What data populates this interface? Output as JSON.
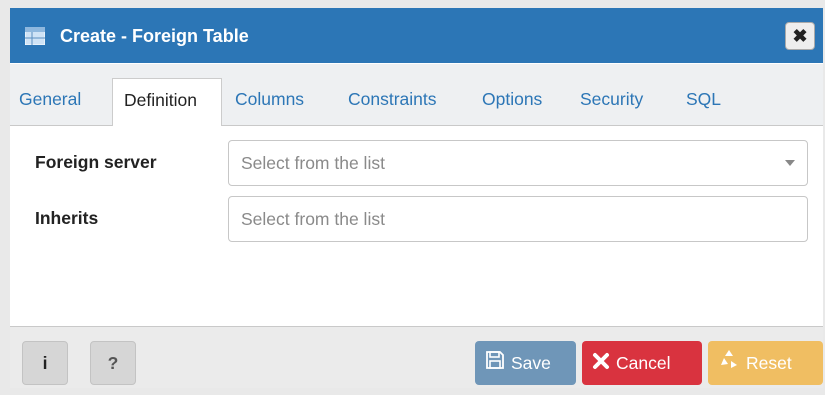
{
  "window": {
    "title": "Create - Foreign Table",
    "close_label": "✖"
  },
  "tabs": [
    {
      "label": "General",
      "active": false
    },
    {
      "label": "Definition",
      "active": true
    },
    {
      "label": "Columns",
      "active": false
    },
    {
      "label": "Constraints",
      "active": false
    },
    {
      "label": "Options",
      "active": false
    },
    {
      "label": "Security",
      "active": false
    },
    {
      "label": "SQL",
      "active": false
    }
  ],
  "form": {
    "foreign_server": {
      "label": "Foreign server",
      "placeholder": "Select from the list"
    },
    "inherits": {
      "label": "Inherits",
      "placeholder": "Select from the list"
    }
  },
  "footer": {
    "info_label": "i",
    "help_label": "?",
    "save_label": "Save",
    "cancel_label": "Cancel",
    "reset_label": "Reset"
  },
  "colors": {
    "accent": "#2c76b6",
    "save": "#6f96b8",
    "cancel": "#d9333f",
    "reset": "#f0be62"
  },
  "icons": [
    "foreign-table-icon",
    "close-icon",
    "dropdown-caret-icon",
    "info-icon",
    "help-icon",
    "save-icon",
    "cancel-icon",
    "reset-icon"
  ]
}
